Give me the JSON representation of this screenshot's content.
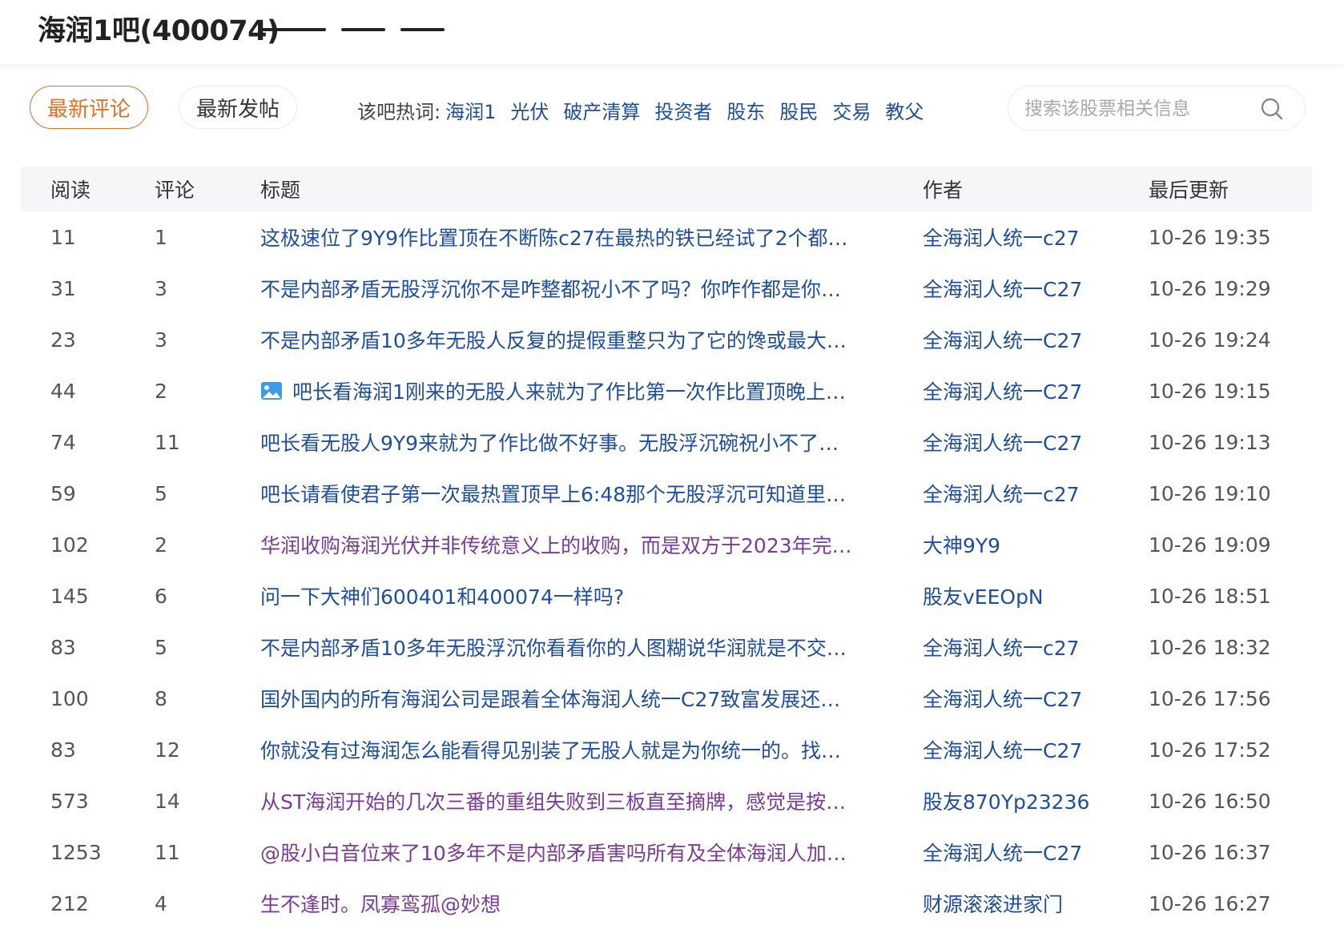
{
  "header": {
    "bar_title": "海润1吧(400074)"
  },
  "toolbar": {
    "tab_latest_comments": "最新评论",
    "tab_latest_posts": "最新发帖",
    "hot_label": "该吧热词:",
    "hot_words": [
      "海润1",
      "光伏",
      "破产清算",
      "投资者",
      "股东",
      "股民",
      "交易",
      "教父"
    ],
    "search_placeholder": "搜索该股票相关信息"
  },
  "colors": {
    "accent": "#e07028",
    "link": "#1f4e9c",
    "visited": "#7a3b98",
    "header_bg": "#f5f6f8"
  },
  "table": {
    "headers": {
      "reads": "阅读",
      "comments": "评论",
      "title": "标题",
      "author": "作者",
      "updated": "最后更新"
    },
    "rows": [
      {
        "reads": "11",
        "comments": "1",
        "title": "这极速位了9Y9作比置顶在不断陈c27在最热的铁已经试了2个都…",
        "author": "全海润人统一c27",
        "updated": "10-26 19:35",
        "visited": false,
        "icon": ""
      },
      {
        "reads": "31",
        "comments": "3",
        "title": "不是内部矛盾无股浮沉你不是咋整都祝小不了吗？你咋作都是你…",
        "author": "全海润人统一C27",
        "updated": "10-26 19:29",
        "visited": false,
        "icon": ""
      },
      {
        "reads": "23",
        "comments": "3",
        "title": "不是内部矛盾10多年无股人反复的提假重整只为了它的馋或最大…",
        "author": "全海润人统一C27",
        "updated": "10-26 19:24",
        "visited": false,
        "icon": ""
      },
      {
        "reads": "44",
        "comments": "2",
        "title": "吧长看海润1刚来的无股人来就为了作比第一次作比置顶晚上…",
        "author": "全海润人统一C27",
        "updated": "10-26 19:15",
        "visited": false,
        "icon": "image-icon"
      },
      {
        "reads": "74",
        "comments": "11",
        "title": "吧长看无股人9Y9来就为了作比做不好事。无股浮沉碗祝小不了…",
        "author": "全海润人统一C27",
        "updated": "10-26 19:13",
        "visited": false,
        "icon": ""
      },
      {
        "reads": "59",
        "comments": "5",
        "title": "吧长请看使君子第一次最热置顶早上6:48那个无股浮沉可知道里…",
        "author": "全海润人统一c27",
        "updated": "10-26 19:10",
        "visited": false,
        "icon": ""
      },
      {
        "reads": "102",
        "comments": "2",
        "title": "华润收购海润光伏并非传统意义上的收购，而是双方于2023年完…",
        "author": "大神9Y9",
        "updated": "10-26 19:09",
        "visited": true,
        "icon": ""
      },
      {
        "reads": "145",
        "comments": "6",
        "title": "问一下大神们600401和400074一样吗?",
        "author": "股友vEEOpN",
        "updated": "10-26 18:51",
        "visited": false,
        "icon": ""
      },
      {
        "reads": "83",
        "comments": "5",
        "title": "不是内部矛盾10多年无股浮沉你看看你的人图糊说华润就是不交…",
        "author": "全海润人统一c27",
        "updated": "10-26 18:32",
        "visited": false,
        "icon": ""
      },
      {
        "reads": "100",
        "comments": "8",
        "title": "国外国内的所有海润公司是跟着全体海润人统一C27致富发展还…",
        "author": "全海润人统一C27",
        "updated": "10-26 17:56",
        "visited": false,
        "icon": ""
      },
      {
        "reads": "83",
        "comments": "12",
        "title": "你就没有过海润怎么能看得见别装了无股人就是为你统一的。找…",
        "author": "全海润人统一C27",
        "updated": "10-26 17:52",
        "visited": false,
        "icon": ""
      },
      {
        "reads": "573",
        "comments": "14",
        "title": "从ST海润开始的几次三番的重组失败到三板直至摘牌，感觉是按…",
        "author": "股友870Yp23236",
        "updated": "10-26 16:50",
        "visited": true,
        "icon": ""
      },
      {
        "reads": "1253",
        "comments": "11",
        "title": "@股小白音位来了10多年不是内部矛盾害吗所有及全体海润人加…",
        "author": "全海润人统一C27",
        "updated": "10-26 16:37",
        "visited": true,
        "icon": ""
      },
      {
        "reads": "212",
        "comments": "4",
        "title": "生不逢时。凤寡鸾孤@妙想",
        "author": "财源滚滚进家门",
        "updated": "10-26 16:27",
        "visited": true,
        "icon": ""
      }
    ]
  }
}
